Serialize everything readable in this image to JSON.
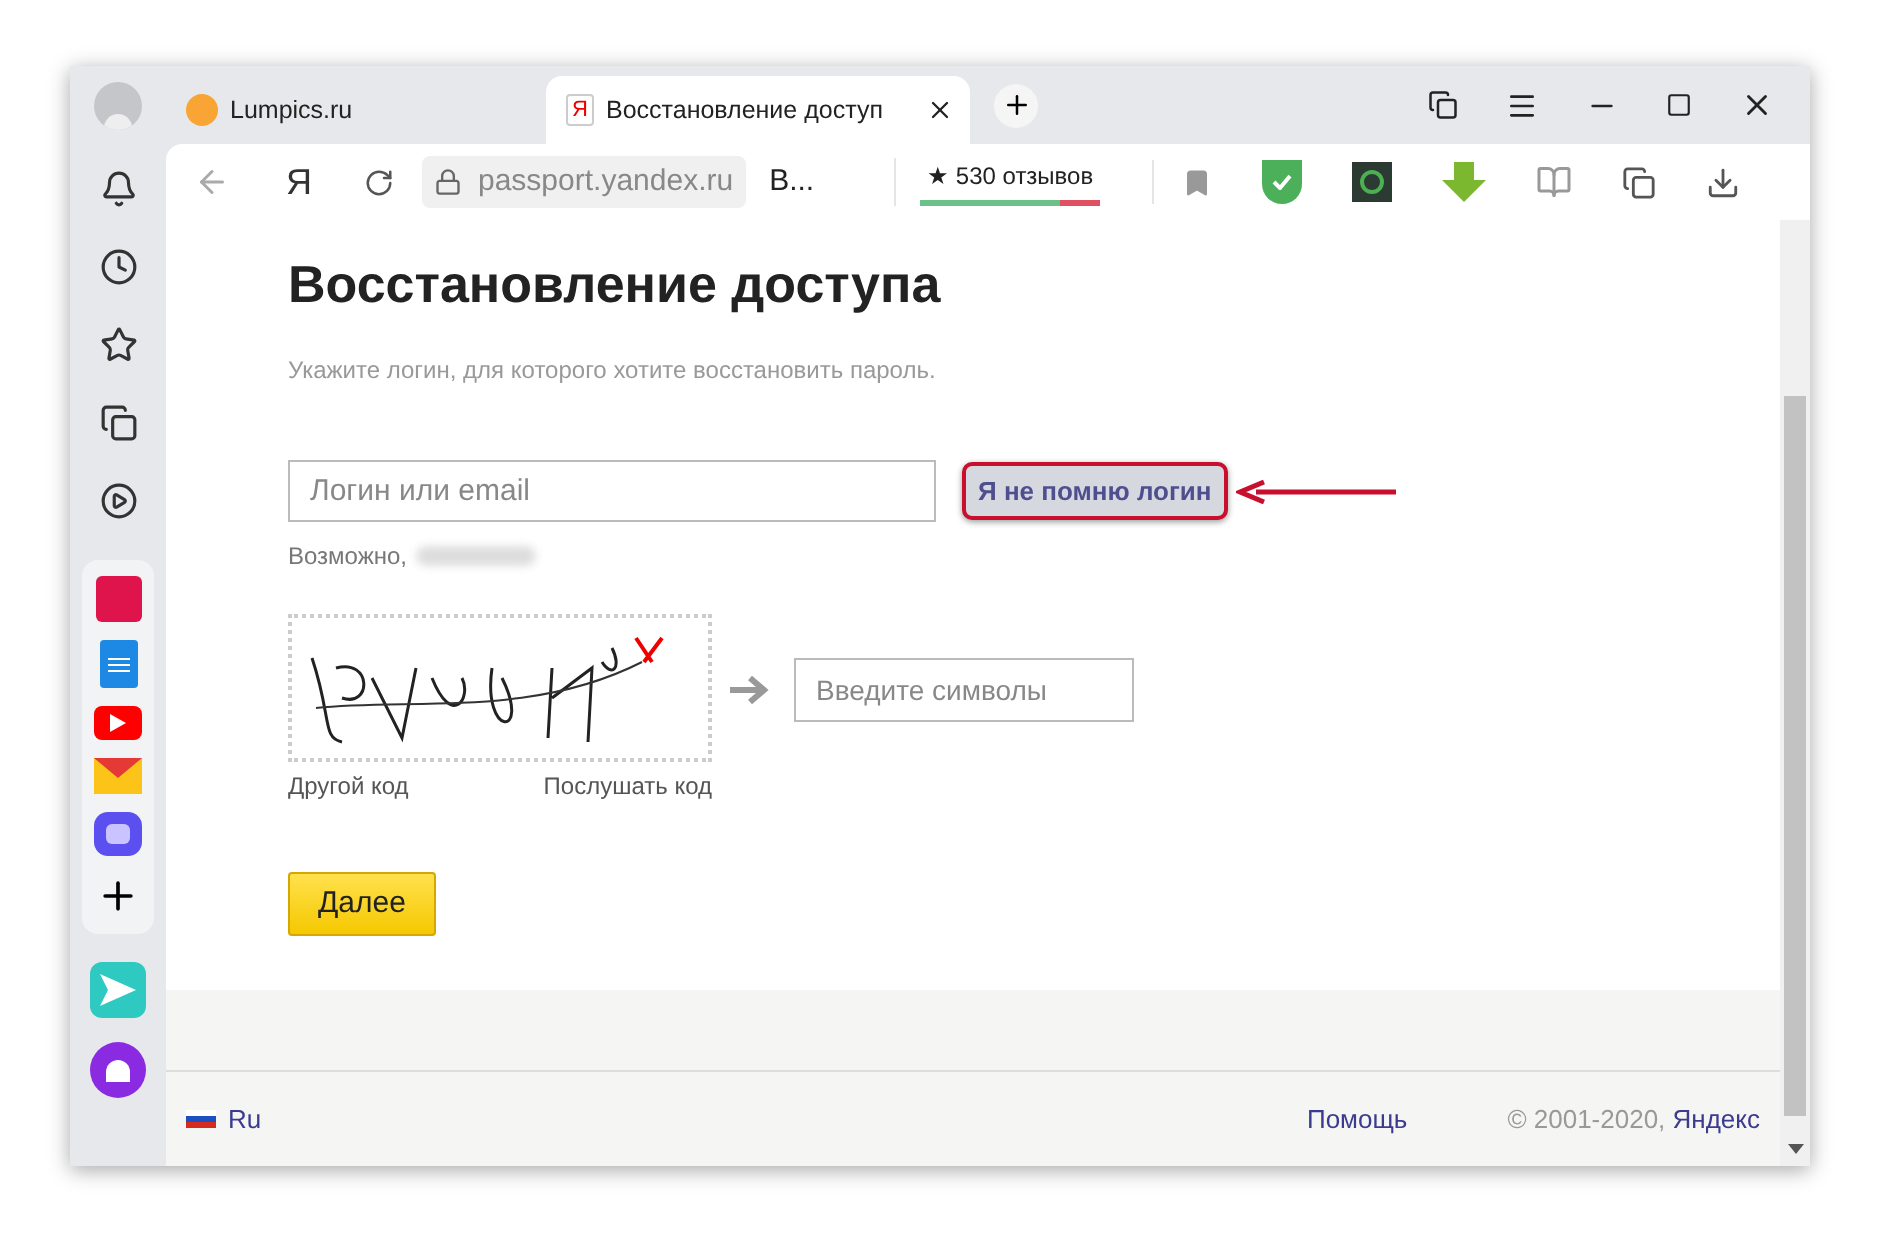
{
  "tabs": [
    {
      "title": "Lumpics.ru",
      "selected": false
    },
    {
      "title": "Восстановление доступ",
      "selected": true,
      "favicon": "Я"
    }
  ],
  "toolbar": {
    "logo": "Я",
    "url": "passport.yandex.ru",
    "page_title": "В...",
    "reviews": {
      "star": "★",
      "label": "530 отзывов",
      "level": 0.78
    }
  },
  "page": {
    "title": "Восстановление доступа",
    "hint": "Укажите логин, для которого хотите восстановить пароль.",
    "login_field": {
      "placeholder": "Логин или email"
    },
    "forgot_link": {
      "label": "Я не помню логин",
      "highlighted": true
    },
    "suggestion": "Возможно,",
    "captcha": {
      "placeholder": "Введите символы",
      "links": [
        "Другой код",
        "Послушать код"
      ]
    },
    "next_button": "Далее"
  },
  "footer": {
    "language": "Ru",
    "help": "Помощь",
    "copyright": "© 2001-2020, ",
    "brand": "Яндекс"
  }
}
